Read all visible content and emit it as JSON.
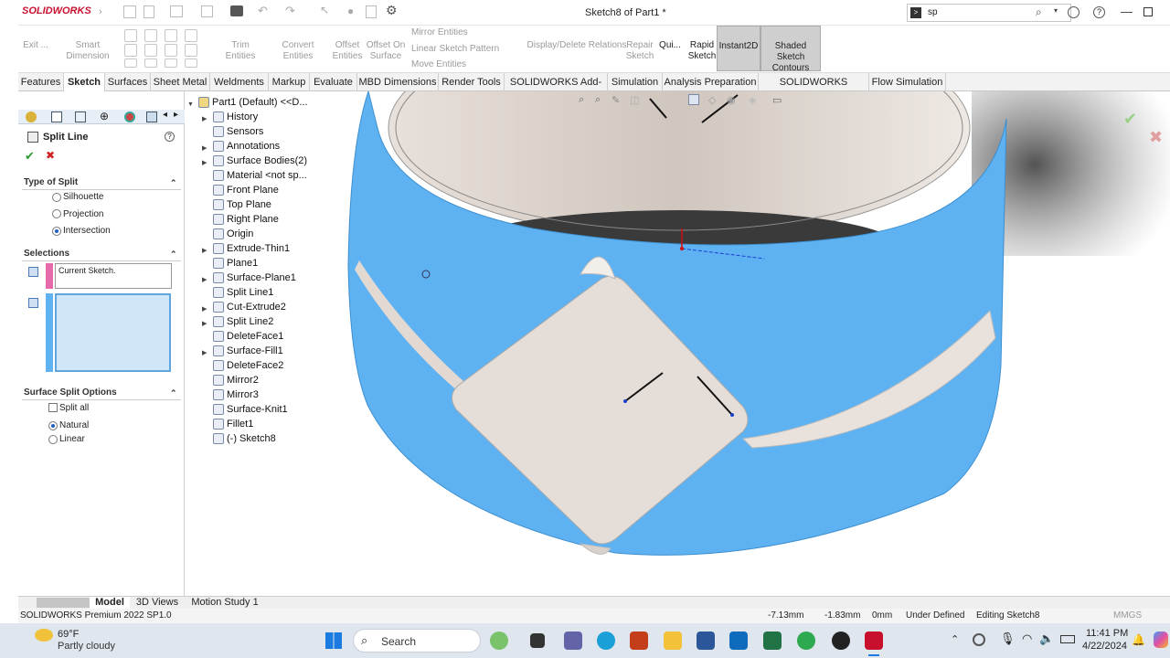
{
  "app": {
    "title": "Sketch8 of Part1 *",
    "logo": "SOLIDWORKS",
    "search_value": "sp"
  },
  "ribbon": {
    "exit": "Exit ...",
    "smart_dimension": "Smart Dimension",
    "trim": "Trim Entities",
    "convert": "Convert Entities",
    "offset": "Offset Entities",
    "offset_surface": "Offset On Surface",
    "mirror": "Mirror Entities",
    "linear_pattern": "Linear Sketch Pattern",
    "move": "Move Entities",
    "display_relations": "Display/Delete Relations",
    "repair": "Repair Sketch",
    "quick": "Qui...",
    "rapid": "Rapid Sketch",
    "instant2d": "Instant2D",
    "shaded_contours": "Shaded Sketch Contours"
  },
  "tabs": [
    "Features",
    "Sketch",
    "Surfaces",
    "Sheet Metal",
    "Weldments",
    "Markup",
    "Evaluate",
    "MBD Dimensions",
    "Render Tools",
    "SOLIDWORKS Add-Ins",
    "Simulation",
    "Analysis Preparation",
    "SOLIDWORKS Visualize",
    "Flow Simulation"
  ],
  "active_tab": "Sketch",
  "property_manager": {
    "title": "Split Line",
    "type_header": "Type of Split",
    "type_options": [
      "Silhouette",
      "Projection",
      "Intersection"
    ],
    "type_selected": "Intersection",
    "selections_header": "Selections",
    "selection_1": "Current Sketch.",
    "options_header": "Surface Split Options",
    "split_all": "Split all",
    "natural": "Natural",
    "linear": "Linear"
  },
  "tree": [
    {
      "label": "Part1 (Default) <<D...",
      "expand": true,
      "root": true
    },
    {
      "label": "History",
      "expand": true
    },
    {
      "label": "Sensors",
      "expand": false
    },
    {
      "label": "Annotations",
      "expand": true
    },
    {
      "label": "Surface Bodies(2)",
      "expand": true
    },
    {
      "label": "Material <not sp...",
      "expand": false
    },
    {
      "label": "Front Plane",
      "expand": false
    },
    {
      "label": "Top Plane",
      "expand": false
    },
    {
      "label": "Right Plane",
      "expand": false
    },
    {
      "label": "Origin",
      "expand": false
    },
    {
      "label": "Extrude-Thin1",
      "expand": true
    },
    {
      "label": "Plane1",
      "expand": false
    },
    {
      "label": "Surface-Plane1",
      "expand": true
    },
    {
      "label": "Split Line1",
      "expand": false
    },
    {
      "label": "Cut-Extrude2",
      "expand": true
    },
    {
      "label": "Split Line2",
      "expand": true
    },
    {
      "label": "DeleteFace1",
      "expand": false
    },
    {
      "label": "Surface-Fill1",
      "expand": true
    },
    {
      "label": "DeleteFace2",
      "expand": false
    },
    {
      "label": "Mirror2",
      "expand": false
    },
    {
      "label": "Mirror3",
      "expand": false
    },
    {
      "label": "Surface-Knit1",
      "expand": false
    },
    {
      "label": "Fillet1",
      "expand": false
    },
    {
      "label": "(-) Sketch8",
      "expand": false
    }
  ],
  "bottom_tabs": [
    "Model",
    "3D Views",
    "Motion Study 1"
  ],
  "status": {
    "product": "SOLIDWORKS Premium 2022 SP1.0",
    "x": "-7.13mm",
    "y": "-1.83mm",
    "z": "0mm",
    "state": "Under Defined",
    "editing": "Editing Sketch8",
    "units": "MMGS"
  },
  "taskbar": {
    "temp": "69°F",
    "weather": "Partly cloudy",
    "search": "Search",
    "time": "11:41 PM",
    "date": "4/22/2024"
  },
  "colors": {
    "accent_blue": "#5fb2f2",
    "tab_bg": "#f2f2f2",
    "selection_box": "#cfe6f8"
  }
}
